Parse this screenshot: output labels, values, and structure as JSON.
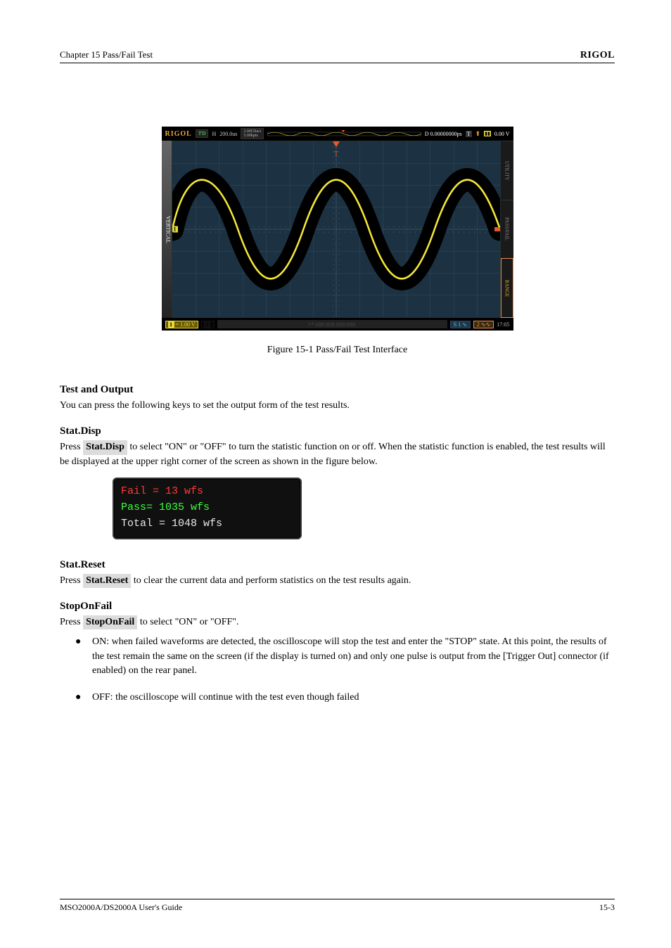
{
  "header": {
    "left": "Chapter 15 Pass/Fail Test",
    "right": "RIGOL"
  },
  "scope": {
    "brand": "RIGOL",
    "tdStatus": "T'D",
    "hLabel": "H",
    "timebase": "200.0us",
    "sampleRateTop": "2.00GSa/s",
    "sampleRateBottom": "5.00kpts",
    "delay": "D 0.00000000ps",
    "trigT": "T",
    "trigLevel": "0.00 V",
    "verticalLabel": "VERTICAL",
    "rightTabs": [
      "UTILITY",
      "PASS/FAIL",
      "RANGE"
    ],
    "ch1": {
      "num": "1",
      "scale": "= 1.00 V"
    },
    "ch2": {
      "num": "2",
      "scale": ""
    },
    "la": "LA",
    "s1": "S 1",
    "s2": "2",
    "clock": "17:05",
    "chMarker": "1"
  },
  "figure": {
    "caption": "Figure 15-1 Pass/Fail Test Interface"
  },
  "test": {
    "heading": "Test and Output",
    "paragraph": "You can press the following keys to set the output form of the test results."
  },
  "stat": {
    "heading": "Stat.Disp",
    "para_before": "Press ",
    "key": "Stat.Disp",
    "para_after": " to select \"ON\" or \"OFF\" to turn the statistic function on or off. When the statistic function is enabled, the test results will be displayed at the upper right corner of the screen as shown in the figure below.",
    "fail": "Fail  = 13  wfs",
    "pass": "Pass= 1035  wfs",
    "total": "Total = 1048  wfs"
  },
  "reset": {
    "heading": "Stat.Reset",
    "para_before": "Press ",
    "key": "Stat.Reset",
    "para_after": " to clear the current data and perform statistics on the test results again."
  },
  "stop": {
    "heading": "StopOnFail",
    "para_before": "Press ",
    "key": "StopOnFail",
    "para_after": " to select \"ON\" or \"OFF\".",
    "bullets": [
      "ON: when failed waveforms are detected, the oscilloscope will stop the test and enter the \"STOP\" state. At this point, the results of the test remain the same on the screen (if the display is turned on) and only one pulse is output from the [Trigger Out] connector (if enabled) on the rear panel.",
      "OFF: the oscilloscope will continue with the test even though failed"
    ]
  },
  "footer": {
    "left": "MSO2000A/DS2000A User's Guide",
    "right": "15-3"
  }
}
